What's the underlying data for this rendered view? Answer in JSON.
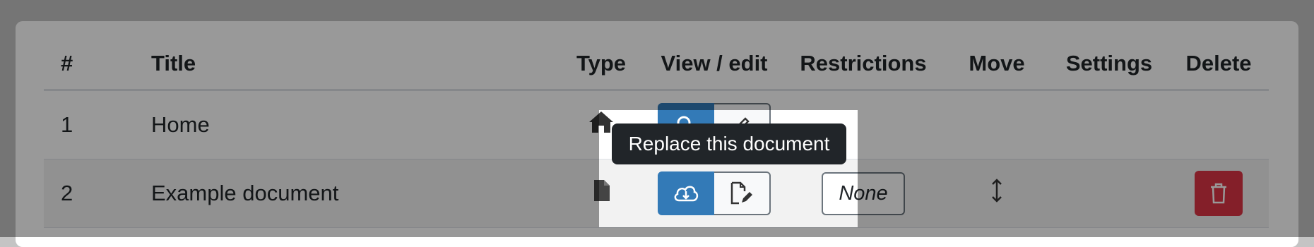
{
  "table": {
    "headers": [
      "#",
      "Title",
      "Type",
      "View / edit",
      "Restrictions",
      "Move",
      "Settings",
      "Delete"
    ],
    "rows": [
      {
        "num": "1",
        "title": "Home",
        "type_icon": "home-icon"
      },
      {
        "num": "2",
        "title": "Example document",
        "type_icon": "file-icon",
        "restriction": "None",
        "view_icon": "cloud-download-icon",
        "edit_icon": "file-edit-icon"
      }
    ]
  },
  "tooltip": {
    "text": "Replace this document"
  },
  "colors": {
    "primary": "#337ab7",
    "danger": "#dc3545",
    "tooltip_bg": "#212529",
    "overlay": "rgba(0,0,0,0.4)"
  }
}
